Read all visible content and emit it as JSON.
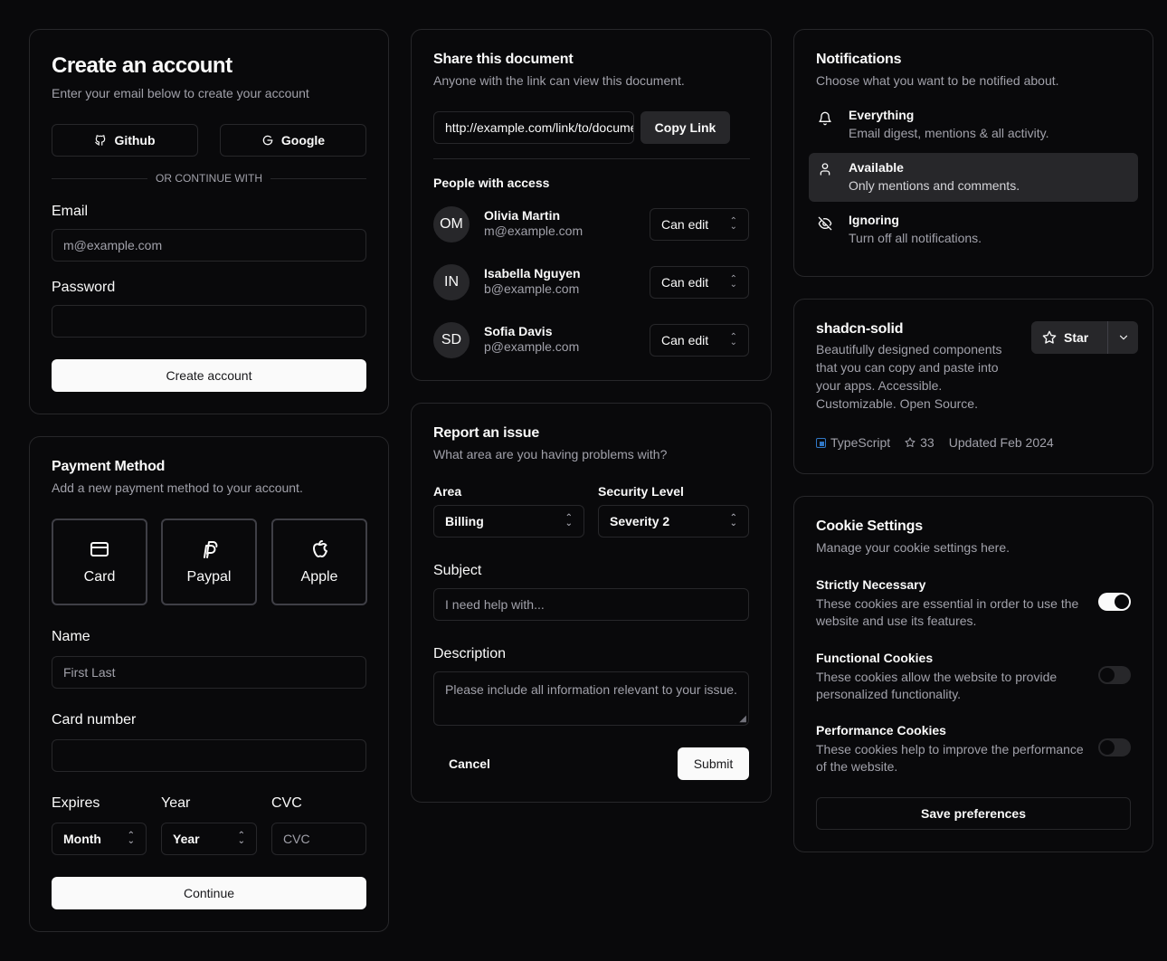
{
  "account": {
    "title": "Create an account",
    "subtitle": "Enter your email below to create your account",
    "github_label": "Github",
    "google_label": "Google",
    "divider": "OR CONTINUE WITH",
    "email_label": "Email",
    "email_placeholder": "m@example.com",
    "password_label": "Password",
    "password_value": "",
    "submit_label": "Create account"
  },
  "payment": {
    "title": "Payment Method",
    "subtitle": "Add a new payment method to your account.",
    "methods": [
      {
        "label": "Card",
        "icon": "credit-card-icon"
      },
      {
        "label": "Paypal",
        "icon": "paypal-icon"
      },
      {
        "label": "Apple",
        "icon": "apple-icon"
      }
    ],
    "name_label": "Name",
    "name_placeholder": "First Last",
    "card_label": "Card number",
    "card_value": "",
    "expires_label": "Expires",
    "month_value": "Month",
    "year_label": "Year",
    "year_value": "Year",
    "cvc_label": "CVC",
    "cvc_placeholder": "CVC",
    "continue_label": "Continue"
  },
  "share": {
    "title": "Share this document",
    "subtitle": "Anyone with the link can view this document.",
    "link_value": "http://example.com/link/to/document",
    "copy_label": "Copy Link",
    "people_heading": "People with access",
    "people": [
      {
        "initials": "OM",
        "name": "Olivia Martin",
        "email": "m@example.com",
        "role": "Can edit"
      },
      {
        "initials": "IN",
        "name": "Isabella Nguyen",
        "email": "b@example.com",
        "role": "Can edit"
      },
      {
        "initials": "SD",
        "name": "Sofia Davis",
        "email": "p@example.com",
        "role": "Can edit"
      }
    ]
  },
  "report": {
    "title": "Report an issue",
    "subtitle": "What area are you having problems with?",
    "area_label": "Area",
    "area_value": "Billing",
    "security_label": "Security Level",
    "security_value": "Severity 2",
    "subject_label": "Subject",
    "subject_placeholder": "I need help with...",
    "description_label": "Description",
    "description_placeholder": "Please include all information relevant to your issue.",
    "cancel_label": "Cancel",
    "submit_label": "Submit"
  },
  "notifications": {
    "title": "Notifications",
    "subtitle": "Choose what you want to be notified about.",
    "options": [
      {
        "title": "Everything",
        "desc": "Email digest, mentions & all activity.",
        "icon": "bell-icon",
        "selected": false
      },
      {
        "title": "Available",
        "desc": "Only mentions and comments.",
        "icon": "user-icon",
        "selected": true
      },
      {
        "title": "Ignoring",
        "desc": "Turn off all notifications.",
        "icon": "eye-off-icon",
        "selected": false
      }
    ]
  },
  "repo": {
    "name": "shadcn-solid",
    "description": "Beautifully designed components that you can copy and paste into your apps. Accessible. Customizable. Open Source.",
    "star_label": "Star",
    "language": "TypeScript",
    "language_color": "#3178c6",
    "stars": "33",
    "updated": "Updated Feb 2024"
  },
  "cookies": {
    "title": "Cookie Settings",
    "subtitle": "Manage your cookie settings here.",
    "items": [
      {
        "title": "Strictly Necessary",
        "desc": "These cookies are essential in order to use the website and use its features.",
        "enabled": true
      },
      {
        "title": "Functional Cookies",
        "desc": "These cookies allow the website to provide personalized functionality.",
        "enabled": false
      },
      {
        "title": "Performance Cookies",
        "desc": "These cookies help to improve the performance of the website.",
        "enabled": false
      }
    ],
    "save_label": "Save preferences"
  }
}
